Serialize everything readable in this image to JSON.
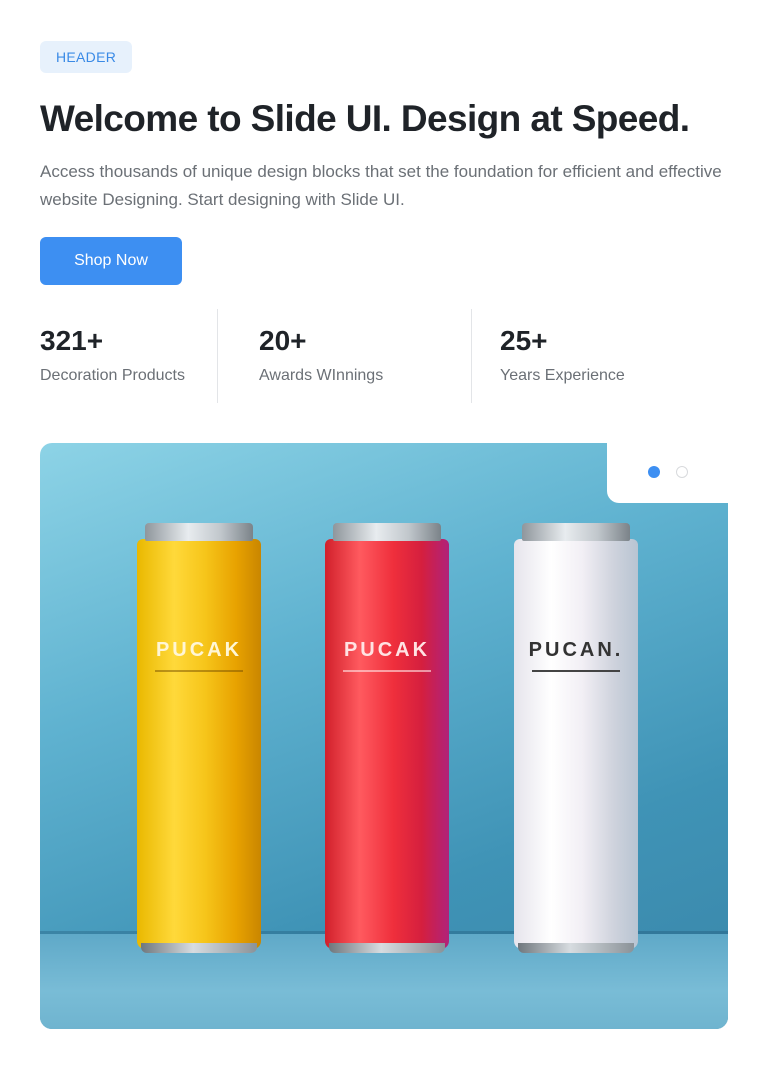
{
  "header": {
    "badge": "HEADER",
    "title": "Welcome to Slide UI. Design at Speed.",
    "description": "Access thousands of unique design blocks that set the foundation for efficient and effective website Designing. Start designing with Slide UI.",
    "cta_label": "Shop Now"
  },
  "stats": [
    {
      "value": "321+",
      "label": "Decoration Products"
    },
    {
      "value": "20+",
      "label": "Awards WInnings"
    },
    {
      "value": "25+",
      "label": "Years Experience"
    }
  ],
  "hero": {
    "cans": [
      {
        "brand": "PUCAK",
        "color": "#f4c21a"
      },
      {
        "brand": "PUCAK",
        "color": "#ea2f3a"
      },
      {
        "brand": "PUCAN.",
        "color": "#f2f0f4"
      }
    ],
    "carousel": {
      "total": 2,
      "active": 1
    }
  },
  "colors": {
    "accent": "#3d8ff2",
    "badge_bg": "#e7f1fc",
    "text": "#1f2328",
    "muted": "#6b7076"
  }
}
